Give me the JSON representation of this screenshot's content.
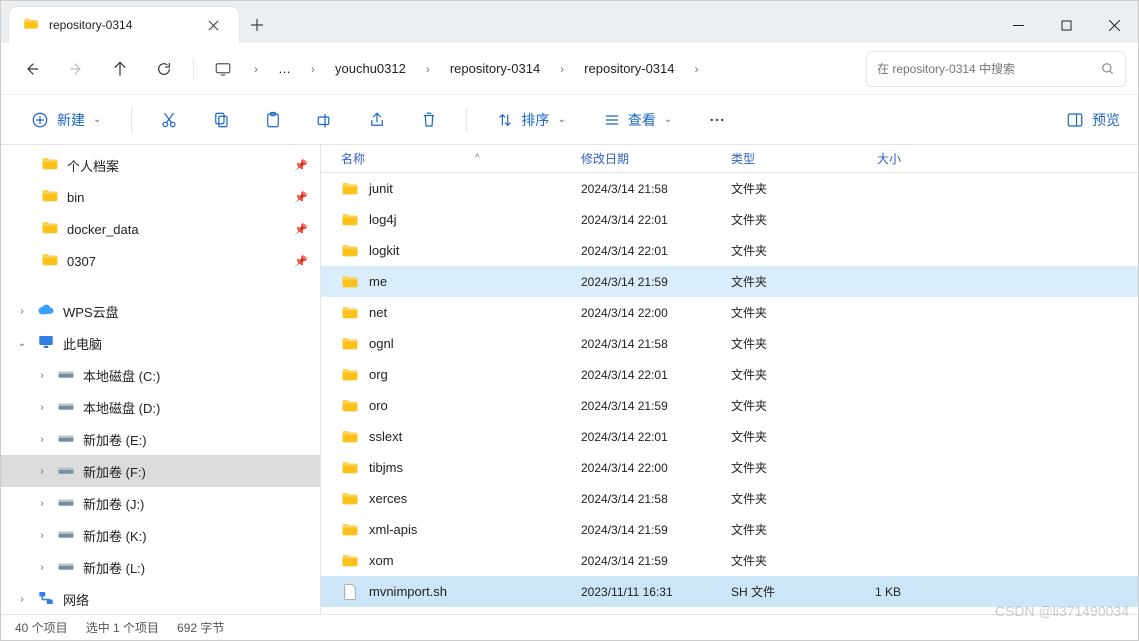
{
  "tab": {
    "title": "repository-0314"
  },
  "breadcrumbs": [
    "youchu0312",
    "repository-0314",
    "repository-0314"
  ],
  "search": {
    "placeholder": "在 repository-0314 中搜索"
  },
  "toolbar": {
    "new": "新建",
    "sort": "排序",
    "view": "查看",
    "preview": "预览"
  },
  "sidebar": {
    "pinned": [
      {
        "label": "个人档案",
        "indent": 40
      },
      {
        "label": "bin",
        "indent": 40
      },
      {
        "label": "docker_data",
        "indent": 40
      },
      {
        "label": "0307",
        "indent": 40
      }
    ],
    "tree": [
      {
        "label": "WPS云盘",
        "icon": "cloud",
        "indent": 14,
        "chev": ">"
      },
      {
        "label": "此电脑",
        "icon": "pc",
        "indent": 14,
        "chev": "v"
      },
      {
        "label": "本地磁盘 (C:)",
        "icon": "drive",
        "indent": 34,
        "chev": ">"
      },
      {
        "label": "本地磁盘 (D:)",
        "icon": "drive",
        "indent": 34,
        "chev": ">"
      },
      {
        "label": "新加卷 (E:)",
        "icon": "drive",
        "indent": 34,
        "chev": ">"
      },
      {
        "label": "新加卷 (F:)",
        "icon": "drive",
        "indent": 34,
        "chev": ">",
        "selected": true
      },
      {
        "label": "新加卷 (J:)",
        "icon": "drive",
        "indent": 34,
        "chev": ">"
      },
      {
        "label": "新加卷 (K:)",
        "icon": "drive",
        "indent": 34,
        "chev": ">"
      },
      {
        "label": "新加卷 (L:)",
        "icon": "drive",
        "indent": 34,
        "chev": ">"
      },
      {
        "label": "网络",
        "icon": "network",
        "indent": 14,
        "chev": ">"
      }
    ]
  },
  "columns": {
    "name": "名称",
    "date": "修改日期",
    "type": "类型",
    "size": "大小",
    "sort": "^"
  },
  "files": [
    {
      "name": "junit",
      "date": "2024/3/14 21:58",
      "type": "文件夹",
      "size": "",
      "icon": "folder"
    },
    {
      "name": "log4j",
      "date": "2024/3/14 22:01",
      "type": "文件夹",
      "size": "",
      "icon": "folder"
    },
    {
      "name": "logkit",
      "date": "2024/3/14 22:01",
      "type": "文件夹",
      "size": "",
      "icon": "folder"
    },
    {
      "name": "me",
      "date": "2024/3/14 21:59",
      "type": "文件夹",
      "size": "",
      "icon": "folder",
      "highlighted": true
    },
    {
      "name": "net",
      "date": "2024/3/14 22:00",
      "type": "文件夹",
      "size": "",
      "icon": "folder"
    },
    {
      "name": "ognl",
      "date": "2024/3/14 21:58",
      "type": "文件夹",
      "size": "",
      "icon": "folder"
    },
    {
      "name": "org",
      "date": "2024/3/14 22:01",
      "type": "文件夹",
      "size": "",
      "icon": "folder"
    },
    {
      "name": "oro",
      "date": "2024/3/14 21:59",
      "type": "文件夹",
      "size": "",
      "icon": "folder"
    },
    {
      "name": "sslext",
      "date": "2024/3/14 22:01",
      "type": "文件夹",
      "size": "",
      "icon": "folder"
    },
    {
      "name": "tibjms",
      "date": "2024/3/14 22:00",
      "type": "文件夹",
      "size": "",
      "icon": "folder"
    },
    {
      "name": "xerces",
      "date": "2024/3/14 21:58",
      "type": "文件夹",
      "size": "",
      "icon": "folder"
    },
    {
      "name": "xml-apis",
      "date": "2024/3/14 21:59",
      "type": "文件夹",
      "size": "",
      "icon": "folder"
    },
    {
      "name": "xom",
      "date": "2024/3/14 21:59",
      "type": "文件夹",
      "size": "",
      "icon": "folder"
    },
    {
      "name": "mvnimport.sh",
      "date": "2023/11/11 16:31",
      "type": "SH 文件",
      "size": "1 KB",
      "icon": "file",
      "selected": true
    }
  ],
  "status": {
    "items": "40 个项目",
    "selected": "选中 1 个项目",
    "size": "692 字节"
  },
  "watermark": "CSDN @li371490034"
}
